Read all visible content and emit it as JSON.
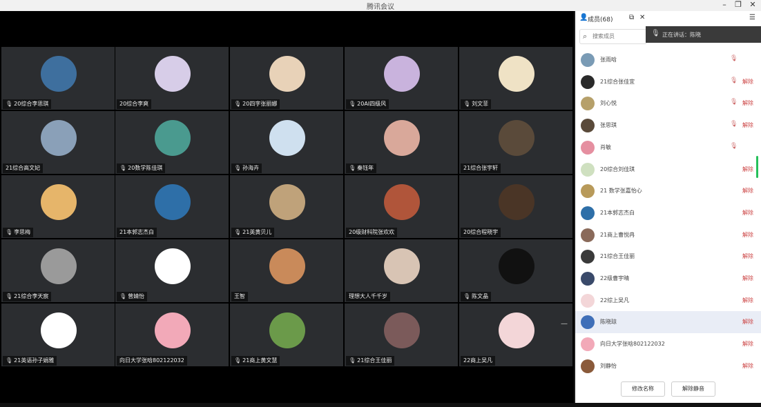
{
  "window": {
    "title": "腾讯会议"
  },
  "tiles": [
    {
      "name": "20综合李思琪",
      "mic": true,
      "color": "#3e6f9e"
    },
    {
      "name": "20综合李爽",
      "mic": false,
      "color": "#d7cde8"
    },
    {
      "name": "20四字张丽娜",
      "mic": true,
      "color": "#e8d2b8"
    },
    {
      "name": "20AI四级风",
      "mic": true,
      "color": "#c9b3dd"
    },
    {
      "name": "刘文菲",
      "mic": true,
      "color": "#efe2c5"
    },
    {
      "name": "21综合高文妃",
      "mic": false,
      "color": "#8aa0b8"
    },
    {
      "name": "20数学陈佳琪",
      "mic": true,
      "color": "#4a9a8f"
    },
    {
      "name": "孙海卉",
      "mic": true,
      "color": "#cfe0ef"
    },
    {
      "name": "秦钰年",
      "mic": true,
      "color": "#d9a89a"
    },
    {
      "name": "21综合张宇轩",
      "mic": false,
      "color": "#5a4a3a"
    },
    {
      "name": "李思梅",
      "mic": true,
      "color": "#e6b56a"
    },
    {
      "name": "21本郭志杰白",
      "mic": false,
      "color": "#2e6fa8"
    },
    {
      "name": "21英黄贝儿",
      "mic": true,
      "color": "#bfa27a"
    },
    {
      "name": "20级财科院张欢欢",
      "mic": false,
      "color": "#b0553a"
    },
    {
      "name": "20综合程晓宇",
      "mic": false,
      "color": "#4a3526"
    },
    {
      "name": "21综合李天宸",
      "mic": true,
      "color": "#9a9a9a"
    },
    {
      "name": "曾婧怡",
      "mic": true,
      "color": "#ffffff"
    },
    {
      "name": "王智",
      "mic": false,
      "color": "#c98a5a"
    },
    {
      "name": "理想大人千千岁",
      "mic": false,
      "color": "#d8c4b4"
    },
    {
      "name": "陈文晶",
      "mic": true,
      "color": "#111111"
    },
    {
      "name": "21英语孙子娟雅",
      "mic": true,
      "color": "#ffffff"
    },
    {
      "name": "向日大学张晗802122032",
      "mic": false,
      "color": "#f2a9b8"
    },
    {
      "name": "21商上黄文慧",
      "mic": true,
      "color": "#6b9a4a"
    },
    {
      "name": "21综合王佳丽",
      "mic": true,
      "color": "#7b5a5a"
    },
    {
      "name": "22商上吴凡",
      "mic": false,
      "color": "#f3d6d8"
    }
  ],
  "sidebar": {
    "title": "成员(68)",
    "search_placeholder": "搜索成员",
    "speaking_text": "正在讲话：陈晓",
    "members": [
      {
        "name": "张雨晗",
        "color": "#7a9bb5",
        "mic": true,
        "muted": false
      },
      {
        "name": "21综合张佳宜",
        "color": "#2a2a2a",
        "mic": true,
        "muted": true
      },
      {
        "name": "刘心悦",
        "color": "#b6a06a",
        "mic": true,
        "muted": true
      },
      {
        "name": "张思琪",
        "color": "#5a4a3a",
        "mic": true,
        "muted": true
      },
      {
        "name": "肖敏",
        "color": "#e58fa0",
        "mic": true,
        "muted": false
      },
      {
        "name": "20综合刘佳琪",
        "color": "#cfe0c0",
        "mic": false,
        "muted": true
      },
      {
        "name": "21 数学张嘉怡心",
        "color": "#b89a5a",
        "mic": false,
        "muted": true
      },
      {
        "name": "21本郭志杰白",
        "color": "#2e6fa8",
        "mic": false,
        "muted": true
      },
      {
        "name": "21商上曹悦冉",
        "color": "#8a6a5a",
        "mic": false,
        "muted": true
      },
      {
        "name": "21综合王佳丽",
        "color": "#3a3a3a",
        "mic": false,
        "muted": true
      },
      {
        "name": "22级曹宇晴",
        "color": "#3a4a6a",
        "mic": false,
        "muted": true
      },
      {
        "name": "22综上吴凡",
        "color": "#f3d6d8",
        "mic": false,
        "muted": true
      },
      {
        "name": "陈晓琼",
        "color": "#3f6fb8",
        "mic": false,
        "muted": true
      },
      {
        "name": "向日大学张晗802122032",
        "color": "#f2a9b8",
        "mic": false,
        "muted": true
      },
      {
        "name": "刘静怡",
        "color": "#8a5a3a",
        "mic": false,
        "muted": true
      }
    ],
    "rename_label": "修改名称",
    "unmute_all_label": "解除静音",
    "muted_label": "解除"
  }
}
